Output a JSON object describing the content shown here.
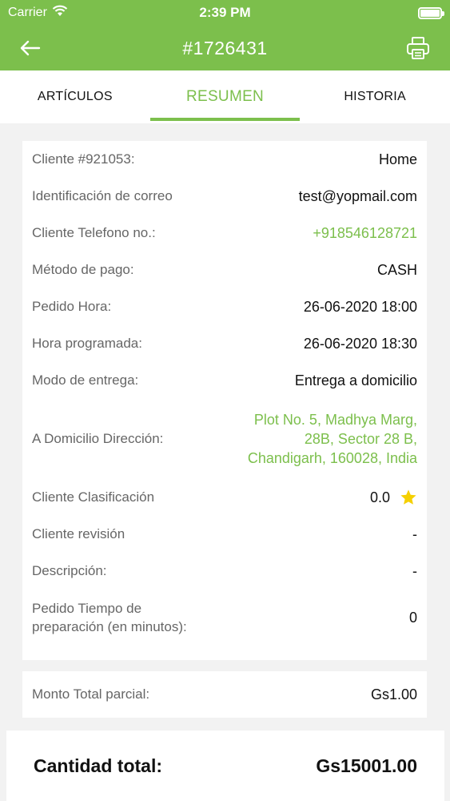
{
  "status": {
    "carrier": "Carrier",
    "time": "2:39 PM"
  },
  "header": {
    "title": "#1726431"
  },
  "tabs": [
    {
      "label": "ARTÍCULOS"
    },
    {
      "label": "RESUMEN"
    },
    {
      "label": "HISTORIA"
    }
  ],
  "details": {
    "client": {
      "label": "Cliente #921053:",
      "value": "Home"
    },
    "email": {
      "label": "Identificación de correo",
      "value": "test@yopmail.com"
    },
    "phone": {
      "label": "Cliente Telefono no.:",
      "value": "+918546128721"
    },
    "payment": {
      "label": "Método de pago:",
      "value": "CASH"
    },
    "order_time": {
      "label": "Pedido Hora:",
      "value": "26-06-2020 18:00"
    },
    "scheduled_time": {
      "label": "Hora programada:",
      "value": "26-06-2020 18:30"
    },
    "delivery_mode": {
      "label": "Modo de entrega:",
      "value": "Entrega a domicilio"
    },
    "address": {
      "label": "A Domicilio Dirección:",
      "value": "Plot No. 5, Madhya Marg, 28B, Sector 28 B, Chandigarh, 160028, India"
    },
    "rating": {
      "label": "Cliente Clasificación",
      "value": "0.0"
    },
    "review": {
      "label": "Cliente revisión",
      "value": "-"
    },
    "description": {
      "label": "Descripción:",
      "value": "-"
    },
    "prep_time": {
      "label_line1": "Pedido Tiempo de",
      "label_line2": "preparación (en minutos):",
      "value": "0"
    }
  },
  "subtotal": {
    "label": "Monto Total parcial:",
    "value": "Gs1.00"
  },
  "total": {
    "label": "Cantidad total:",
    "value": "Gs15001.00"
  },
  "colors": {
    "accent": "#7cbf4c",
    "star": "#f5d000"
  }
}
